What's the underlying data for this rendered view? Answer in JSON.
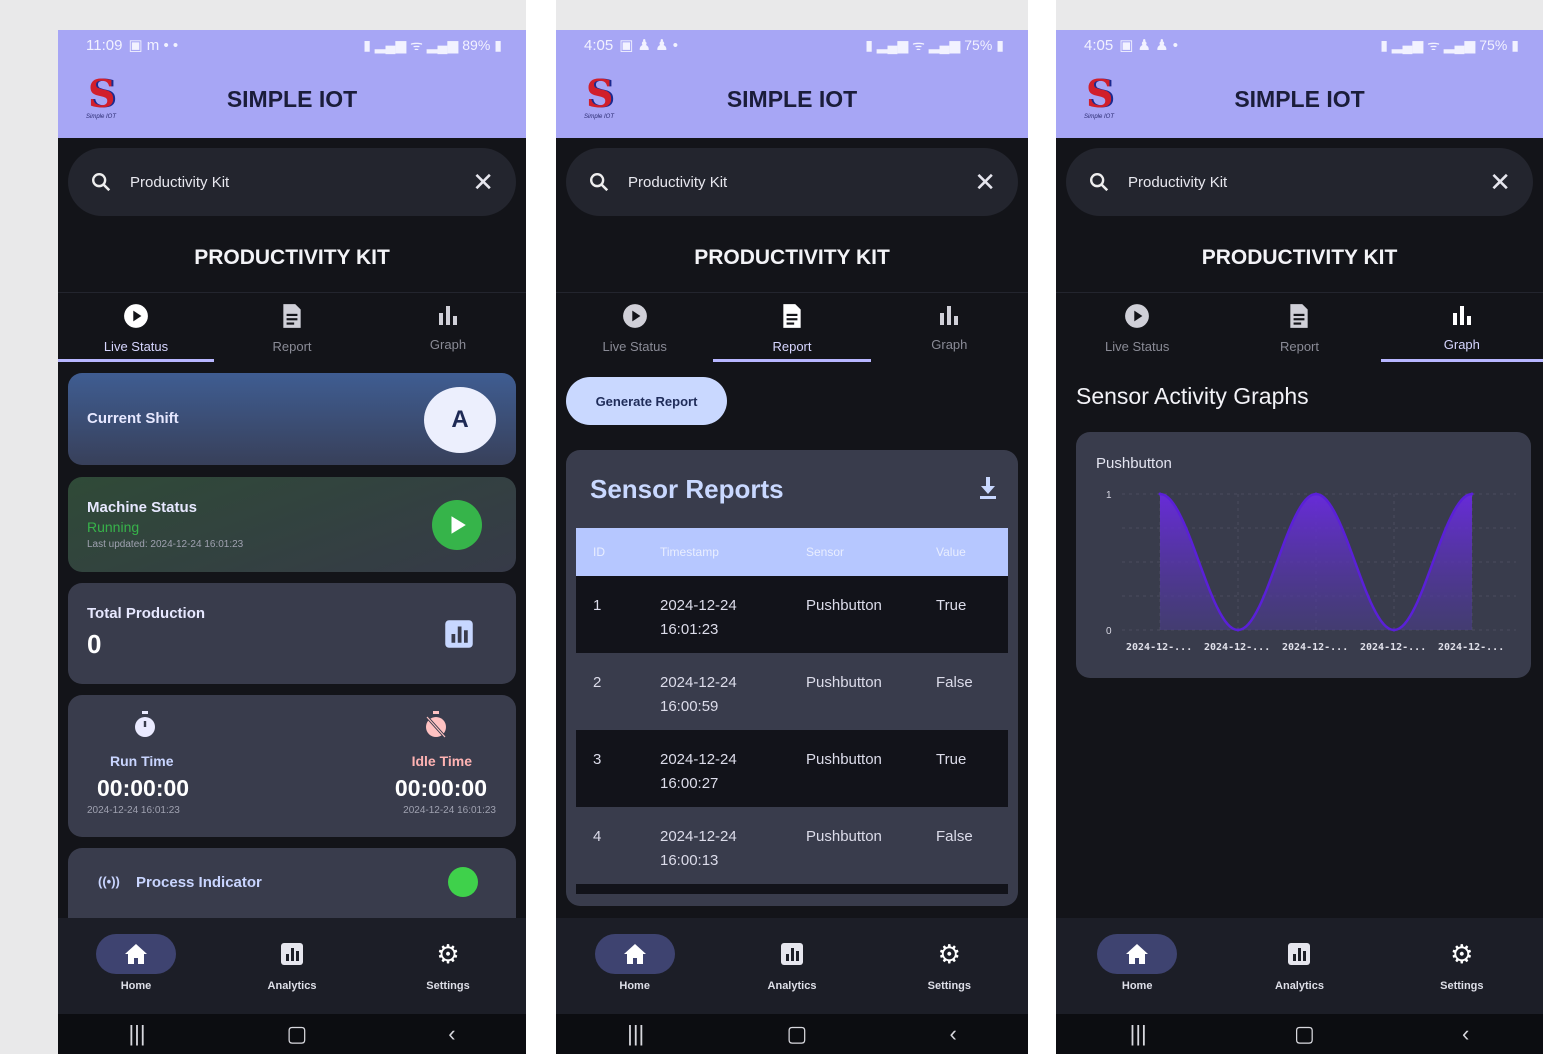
{
  "app": {
    "name": "SIMPLE IOT",
    "search_query": "Productivity Kit",
    "page_title": "PRODUCTIVITY KIT",
    "tabs": [
      "Live Status",
      "Report",
      "Graph"
    ],
    "nav": [
      "Home",
      "Analytics",
      "Settings"
    ]
  },
  "screen1": {
    "status_time": "11:09",
    "status_right": "89%",
    "current_shift": {
      "label": "Current Shift",
      "value": "A"
    },
    "machine": {
      "label": "Machine Status",
      "state": "Running",
      "updated": "Last updated: 2024-12-24 16:01:23"
    },
    "production": {
      "label": "Total Production",
      "value": "0"
    },
    "run": {
      "label": "Run Time",
      "value": "00:00:00",
      "stamp": "2024-12-24 16:01:23"
    },
    "idle": {
      "label": "Idle Time",
      "value": "00:00:00",
      "stamp": "2024-12-24 16:01:23"
    },
    "process": {
      "label": "Process Indicator"
    }
  },
  "screen2": {
    "status_time": "4:05",
    "status_right": "75%",
    "generate_button": "Generate Report",
    "reports_title": "Sensor Reports",
    "columns": [
      "ID",
      "Timestamp",
      "Sensor",
      "Value"
    ],
    "rows": [
      {
        "id": "1",
        "date": "2024-12-24",
        "time": "16:01:23",
        "sensor": "Pushbutton",
        "value": "True"
      },
      {
        "id": "2",
        "date": "2024-12-24",
        "time": "16:00:59",
        "sensor": "Pushbutton",
        "value": "False"
      },
      {
        "id": "3",
        "date": "2024-12-24",
        "time": "16:00:27",
        "sensor": "Pushbutton",
        "value": "True"
      },
      {
        "id": "4",
        "date": "2024-12-24",
        "time": "16:00:13",
        "sensor": "Pushbutton",
        "value": "False"
      }
    ]
  },
  "screen3": {
    "status_time": "4:05",
    "status_right": "75%",
    "graphs_title": "Sensor Activity Graphs"
  },
  "colors": {
    "accent": "#a7a6f5",
    "background": "#131419",
    "card": "#393c4c",
    "running": "#36b44a",
    "idle": "#ffb3b3",
    "line": "#5a20d8"
  },
  "chart_data": {
    "type": "area",
    "title": "Pushbutton",
    "x": [
      "2024-12-...",
      "2024-12-...",
      "2024-12-...",
      "2024-12-...",
      "2024-12-..."
    ],
    "series": [
      {
        "name": "Pushbutton",
        "values": [
          1,
          0,
          1,
          0,
          1
        ]
      }
    ],
    "ylim": [
      0,
      1
    ],
    "yticks": [
      "1",
      "0"
    ],
    "grid": true
  }
}
